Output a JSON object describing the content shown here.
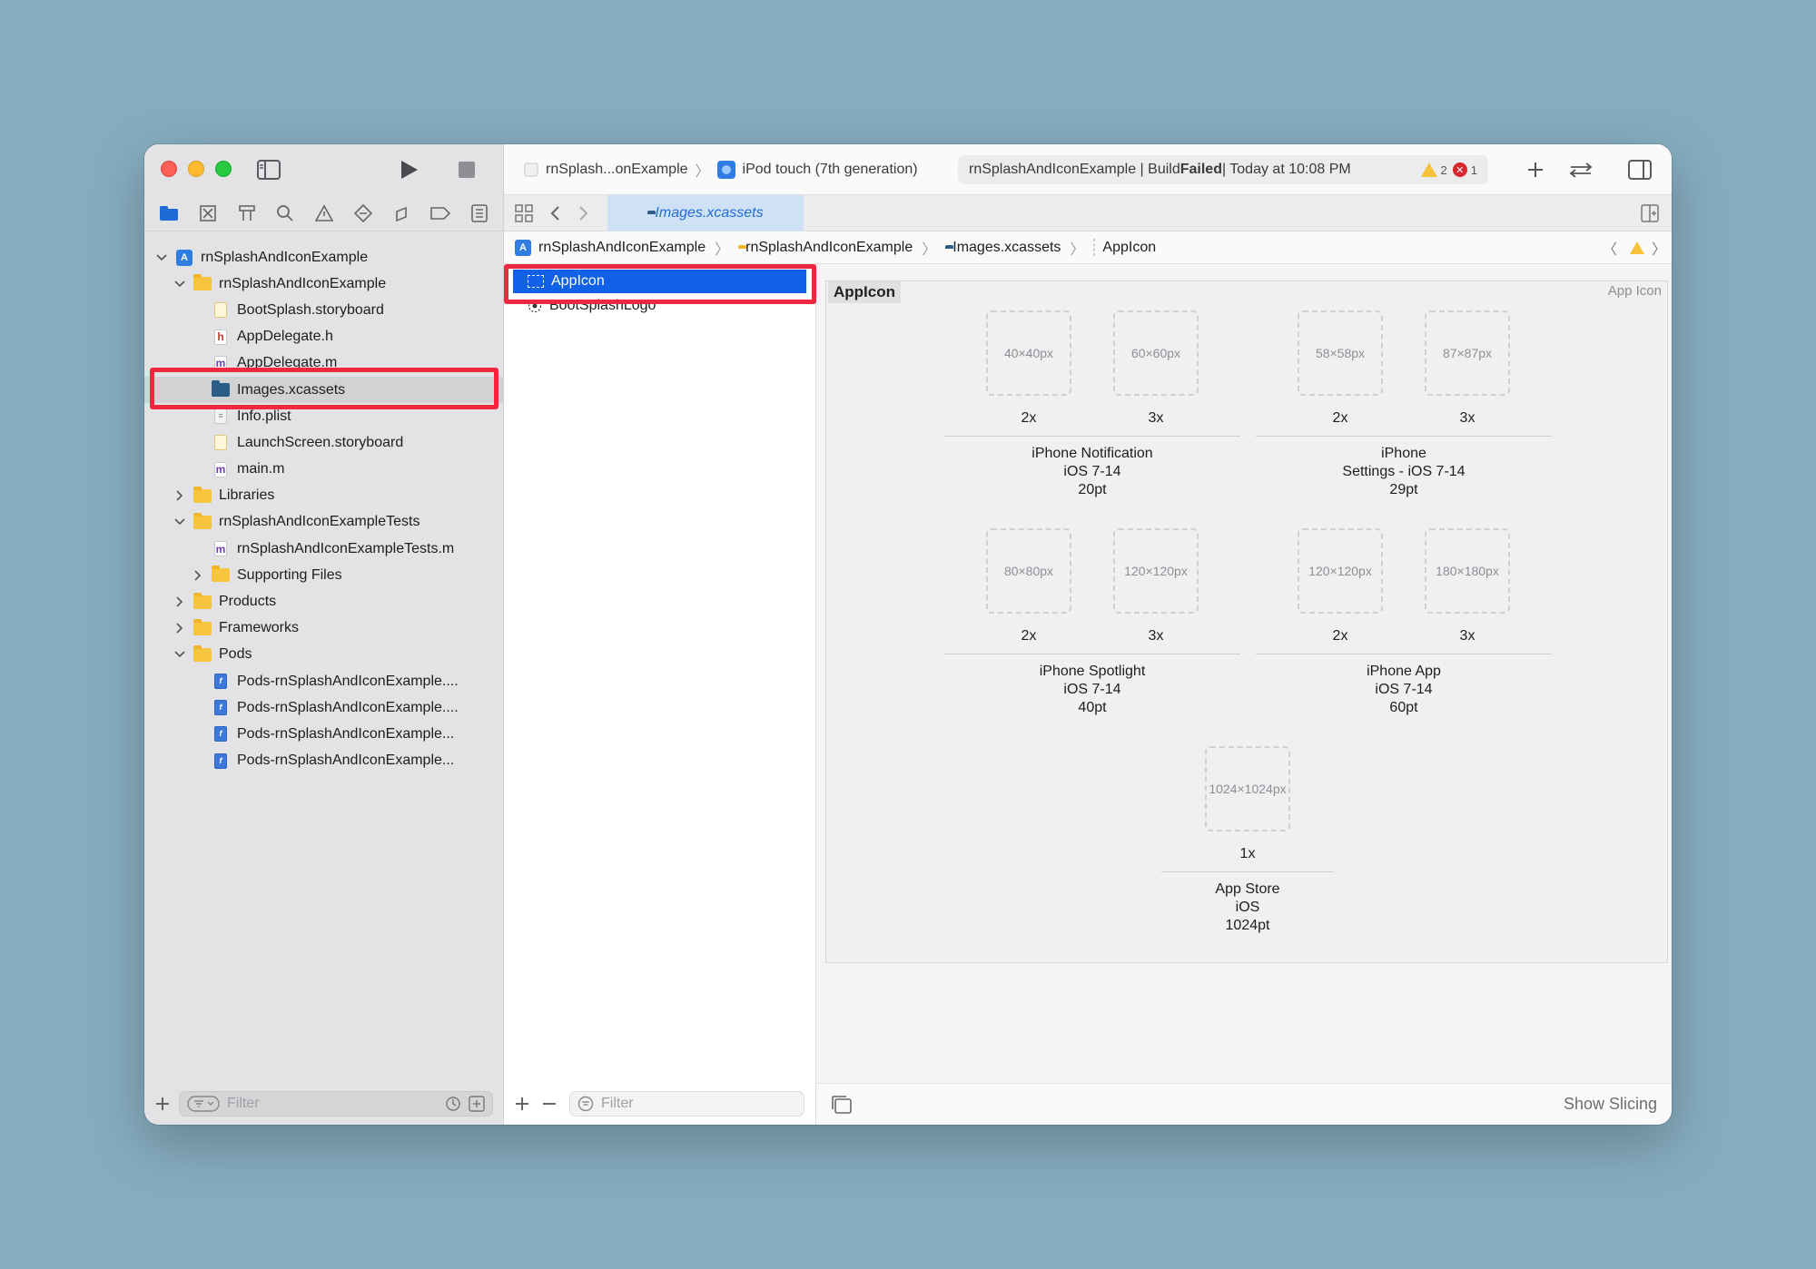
{
  "toolbar": {
    "scheme_name": "rnSplash...onExample",
    "device": "iPod touch (7th generation)",
    "status_project": "rnSplashAndIconExample | Build ",
    "status_result": "Failed",
    "status_time": " | Today at 10:08 PM",
    "warnings": "2",
    "errors": "1"
  },
  "tab": {
    "label": "Images.xcassets"
  },
  "navigator": {
    "items": [
      {
        "label": "rnSplashAndIconExample",
        "indent": 0,
        "chev": "down",
        "icon": "project"
      },
      {
        "label": "rnSplashAndIconExample",
        "indent": 1,
        "chev": "down",
        "icon": "folder"
      },
      {
        "label": "BootSplash.storyboard",
        "indent": 2,
        "chev": "",
        "icon": "storyboard"
      },
      {
        "label": "AppDelegate.h",
        "indent": 2,
        "chev": "",
        "icon": "h"
      },
      {
        "label": "AppDelegate.m",
        "indent": 2,
        "chev": "",
        "icon": "m"
      },
      {
        "label": "Images.xcassets",
        "indent": 2,
        "chev": "",
        "icon": "xcassets",
        "selected": true
      },
      {
        "label": "Info.plist",
        "indent": 2,
        "chev": "",
        "icon": "plist"
      },
      {
        "label": "LaunchScreen.storyboard",
        "indent": 2,
        "chev": "",
        "icon": "storyboard"
      },
      {
        "label": "main.m",
        "indent": 2,
        "chev": "",
        "icon": "m"
      },
      {
        "label": "Libraries",
        "indent": 1,
        "chev": "right",
        "icon": "folder"
      },
      {
        "label": "rnSplashAndIconExampleTests",
        "indent": 1,
        "chev": "down",
        "icon": "folder"
      },
      {
        "label": "rnSplashAndIconExampleTests.m",
        "indent": 2,
        "chev": "",
        "icon": "m"
      },
      {
        "label": "Supporting Files",
        "indent": 2,
        "chev": "right",
        "icon": "folder"
      },
      {
        "label": "Products",
        "indent": 1,
        "chev": "right",
        "icon": "folder"
      },
      {
        "label": "Frameworks",
        "indent": 1,
        "chev": "right",
        "icon": "folder"
      },
      {
        "label": "Pods",
        "indent": 1,
        "chev": "down",
        "icon": "folder"
      },
      {
        "label": "Pods-rnSplashAndIconExample....",
        "indent": 2,
        "chev": "",
        "icon": "pod"
      },
      {
        "label": "Pods-rnSplashAndIconExample....",
        "indent": 2,
        "chev": "",
        "icon": "pod"
      },
      {
        "label": "Pods-rnSplashAndIconExample...",
        "indent": 2,
        "chev": "",
        "icon": "pod"
      },
      {
        "label": "Pods-rnSplashAndIconExample...",
        "indent": 2,
        "chev": "",
        "icon": "pod"
      }
    ],
    "filter_placeholder": "Filter"
  },
  "jumpbar": {
    "crumbs": [
      "rnSplashAndIconExample",
      "rnSplashAndIconExample",
      "Images.xcassets",
      "AppIcon"
    ]
  },
  "assets": {
    "items": [
      "AppIcon",
      "BootSplashLogo"
    ],
    "filter_placeholder": "Filter"
  },
  "editor": {
    "title": "AppIcon",
    "kind": "App Icon",
    "groups": [
      {
        "slots": [
          {
            "size": "40×40px",
            "scale": "2x"
          },
          {
            "size": "60×60px",
            "scale": "3x"
          }
        ],
        "label": [
          "iPhone Notification",
          "iOS 7-14",
          "20pt"
        ]
      },
      {
        "slots": [
          {
            "size": "58×58px",
            "scale": "2x"
          },
          {
            "size": "87×87px",
            "scale": "3x"
          }
        ],
        "label": [
          "iPhone",
          "Settings - iOS 7-14",
          "29pt"
        ]
      },
      {
        "slots": [
          {
            "size": "80×80px",
            "scale": "2x"
          },
          {
            "size": "120×120px",
            "scale": "3x"
          }
        ],
        "label": [
          "iPhone Spotlight",
          "iOS 7-14",
          "40pt"
        ]
      },
      {
        "slots": [
          {
            "size": "120×120px",
            "scale": "2x"
          },
          {
            "size": "180×180px",
            "scale": "3x"
          }
        ],
        "label": [
          "iPhone App",
          "iOS 7-14",
          "60pt"
        ]
      },
      {
        "slots": [
          {
            "size": "1024×1024px",
            "scale": "1x"
          }
        ],
        "label": [
          "App Store",
          "iOS",
          "1024pt"
        ]
      }
    ],
    "show_slicing": "Show Slicing"
  }
}
